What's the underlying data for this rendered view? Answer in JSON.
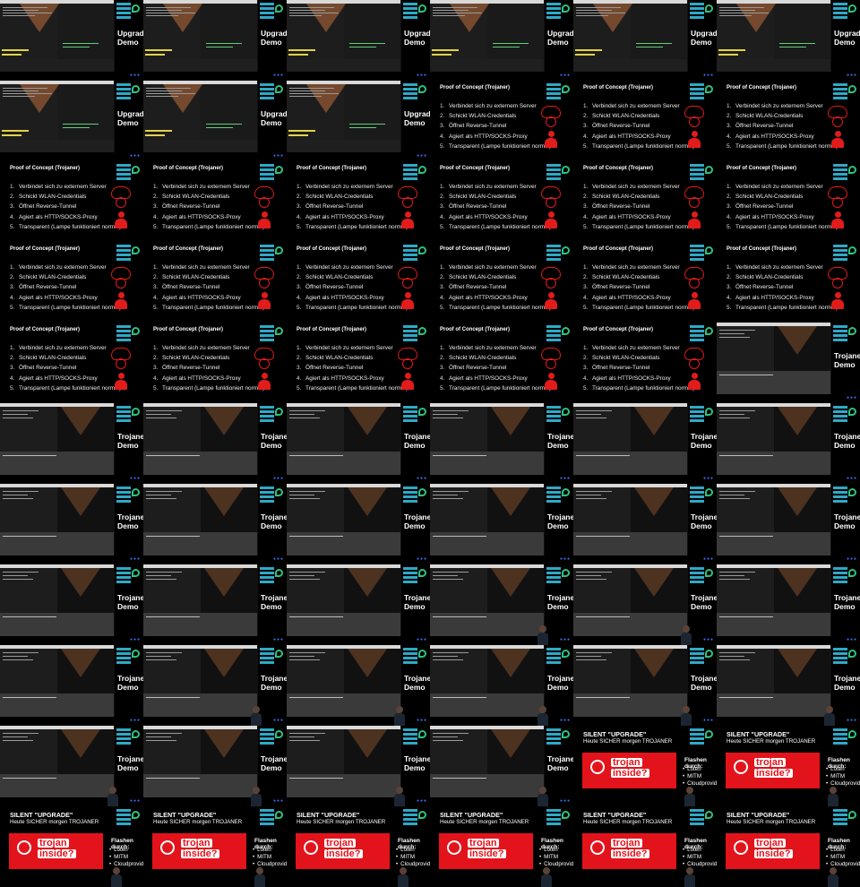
{
  "demo_labels": {
    "upgrade": [
      "Upgrade",
      "Demo"
    ],
    "trojaner": [
      "Trojaner",
      "Demo"
    ]
  },
  "poc": {
    "title": "Proof of Concept (Trojaner)",
    "items": [
      "Verbindet sich zu externem Server",
      "Schickt WLAN-Credentials",
      "Öffnet Reverse-Tunnel",
      "Agiert als HTTP/SOCKS-Proxy",
      "Transparent (Lampe funktioniert normal)"
    ]
  },
  "silent": {
    "title": "SILENT \"UPGRADE\"",
    "subtitle": "Heute SICHER morgen TROJANER",
    "badge_line1": "trojan",
    "badge_line2": "inside?",
    "flash_heading": "Flashen durch:",
    "flash_items": [
      "Löten",
      "MITM",
      "Cloudprovider"
    ]
  },
  "layout_sequence": [
    "U",
    "U",
    "U",
    "U",
    "U",
    "U",
    "U",
    "U",
    "U",
    "P",
    "P",
    "P",
    "P",
    "P",
    "P",
    "P",
    "P",
    "P",
    "P",
    "P",
    "P",
    "P",
    "P",
    "P",
    "P",
    "P",
    "P",
    "P",
    "P",
    "T",
    "T",
    "T",
    "T",
    "T",
    "T",
    "T",
    "T",
    "T",
    "T",
    "T",
    "T",
    "T",
    "T",
    "T",
    "T",
    "T",
    "T",
    "T",
    "T",
    "T",
    "T",
    "T",
    "T",
    "T",
    "T",
    "T",
    "T",
    "T",
    "S",
    "S",
    "S",
    "S",
    "S",
    "S",
    "S",
    "S"
  ],
  "speaker_cells": [
    45,
    46,
    49,
    50,
    51,
    52,
    53,
    54,
    55,
    56,
    57,
    58,
    59,
    60,
    61,
    62,
    63,
    64,
    65
  ],
  "colors": {
    "accent_red": "#e3131b",
    "logo_blue": "#2fa9c7",
    "logo_green": "#2ec27e",
    "terminal_bg": "#2b2b2b",
    "slide_dots": "#3b6df0"
  },
  "icons": {
    "logo": "conference-logo",
    "cloud": "cloud-icon",
    "bulb": "lightbulb-icon",
    "person": "person-icon",
    "trojan_badge": "trojan-inside-badge"
  }
}
